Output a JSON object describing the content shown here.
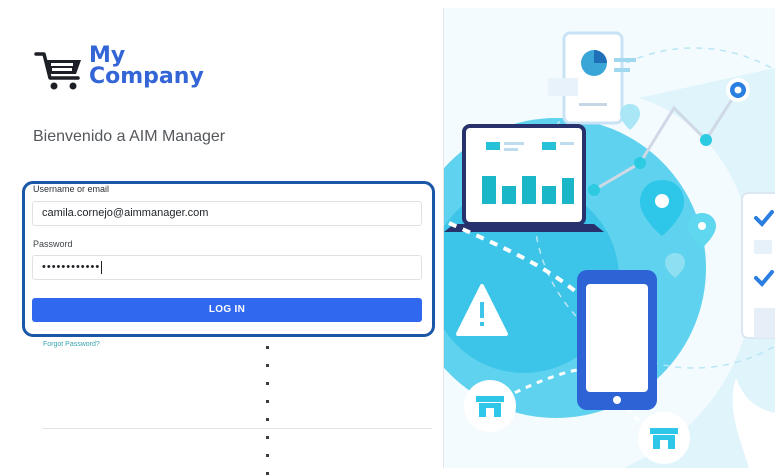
{
  "brand": {
    "line1": "My",
    "line2": "Company",
    "color": "#3465d6"
  },
  "welcome_text": "Bienvenido a AIM Manager",
  "form": {
    "username_label": "Username or email",
    "username_value": "camila.cornejo@aimmanager.com",
    "password_label": "Password",
    "password_value": "••••••••••••",
    "login_button": "LOG IN",
    "forgot_password": "Forgot Password?"
  },
  "colors": {
    "primary": "#3168f0",
    "highlight": "#1a58a7",
    "illustration_accent": "#2ec7ea"
  },
  "icons": {
    "logo": "shopping-cart-icon",
    "illustration": [
      "phone-chart-icon",
      "laptop-chart-icon",
      "map-pin-icon",
      "warning-icon",
      "store-icon",
      "smartphone-icon",
      "checklist-icon"
    ]
  }
}
